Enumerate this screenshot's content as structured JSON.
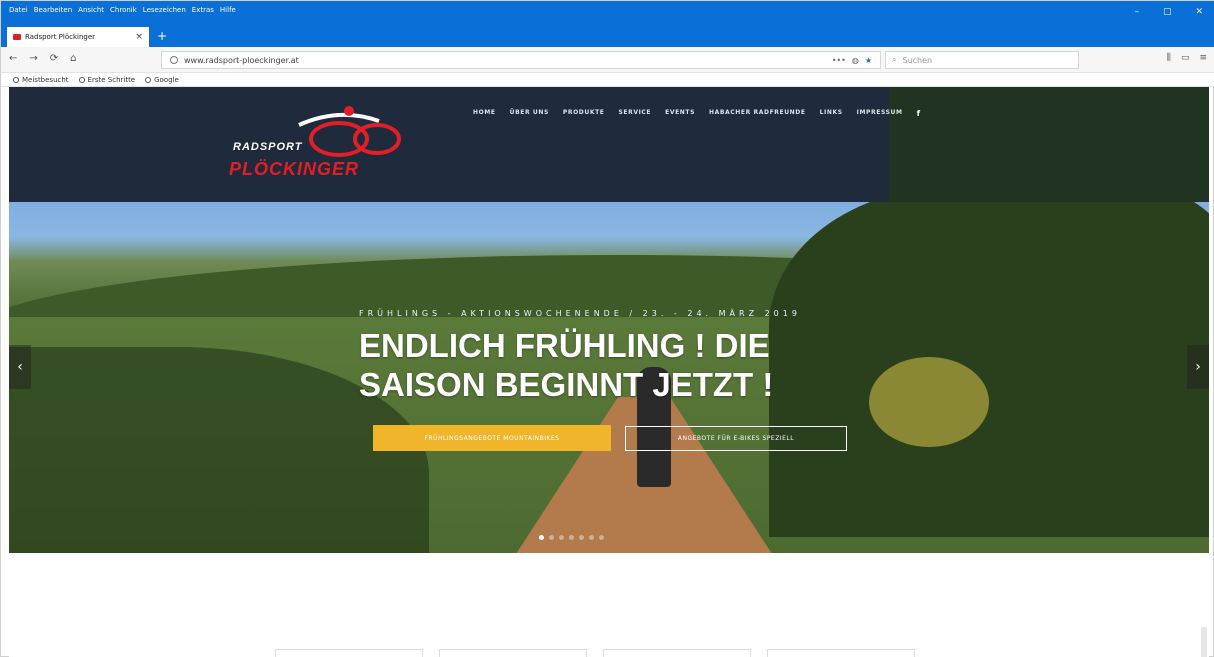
{
  "browser": {
    "menu": [
      "Datei",
      "Bearbeiten",
      "Ansicht",
      "Chronik",
      "Lesezeichen",
      "Extras",
      "Hilfe"
    ],
    "window_controls": [
      "–",
      "▢",
      "✕"
    ],
    "tab_title": "Radsport Plöckinger",
    "url": "www.radsport-ploeckinger.at",
    "search_placeholder": "Suchen",
    "bookmarks": [
      "Meistbesucht",
      "Erste Schritte",
      "Google"
    ]
  },
  "site": {
    "logo_top": "RADSPORT",
    "logo_bottom": "PLÖCKINGER",
    "nav": [
      "HOME",
      "ÜBER UNS",
      "PRODUKTE",
      "SERVICE",
      "EVENTS",
      "HABACHER RADFREUNDE",
      "LINKS",
      "IMPRESSUM"
    ],
    "facebook": "f"
  },
  "hero": {
    "kicker": "FRÜHLINGS - AKTIONSWOCHENENDE / 23. - 24. MÄRZ 2019",
    "headline": "ENDLICH FRÜHLING ! DIE SAISON BEGINNT JETZT !",
    "primary_button": "FRÜHLINGSANGEBOTE MOUNTAINBIKES",
    "secondary_button": "ANGEBOTE FÜR E-BIKES SPEZIELL",
    "slide_count": 7,
    "active_slide": 1
  },
  "colors": {
    "browser_blue": "#0a6fd6",
    "header_navy": "#1f2a3c",
    "logo_red": "#e31e26",
    "button_yellow": "#f0b52b"
  },
  "icons": {
    "back": "←",
    "forward": "→",
    "reload": "⟳",
    "home": "⌂",
    "star": "★",
    "pocket": "◍",
    "menu": "≡",
    "library": "⫼",
    "sidebar": "▭",
    "prev": "‹",
    "next": "›"
  }
}
